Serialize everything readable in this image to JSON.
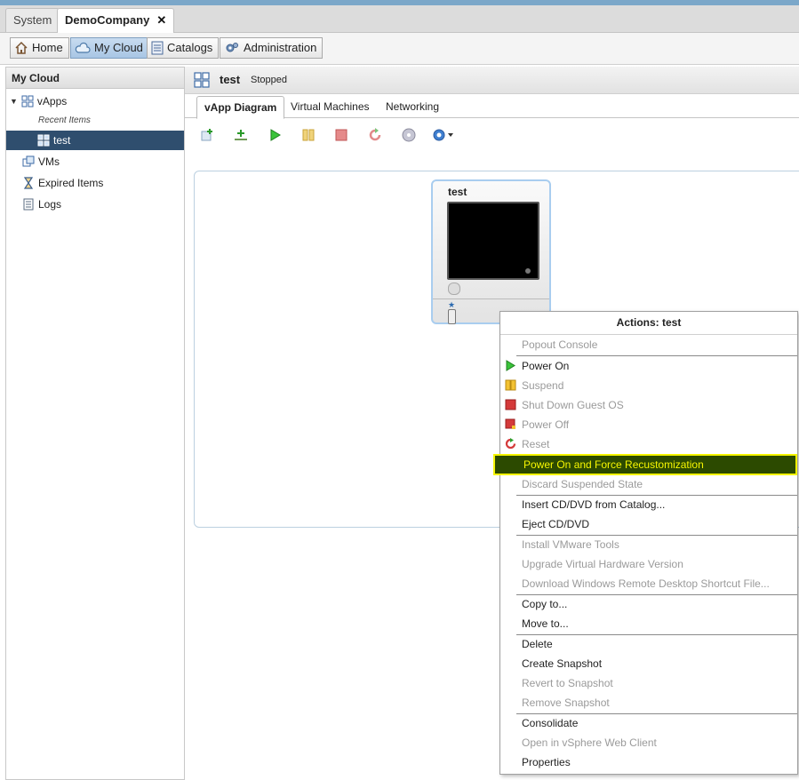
{
  "tabs": {
    "system": "System",
    "demo": "DemoCompany",
    "close": "✕"
  },
  "nav": {
    "home": "Home",
    "mycloud": "My Cloud",
    "catalogs": "Catalogs",
    "administration": "Administration"
  },
  "left_panel": {
    "title": "My Cloud",
    "vapps": "vApps",
    "recent": "Recent Items",
    "test": "test",
    "vms": "VMs",
    "expired": "Expired Items",
    "logs": "Logs"
  },
  "vapp": {
    "name": "test",
    "status": "Stopped"
  },
  "subtabs": {
    "diagram": "vApp Diagram",
    "vms": "Virtual Machines",
    "networking": "Networking"
  },
  "vm_card": {
    "name": "test"
  },
  "menu": {
    "title": "Actions: test",
    "items": [
      "Popout Console",
      "Power On",
      "Suspend",
      "Shut Down Guest OS",
      "Power Off",
      "Reset",
      "Power On and Force Recustomization",
      "Discard Suspended State",
      "Insert CD/DVD from Catalog...",
      "Eject CD/DVD",
      "Install VMware Tools",
      "Upgrade Virtual Hardware Version",
      "Download Windows Remote Desktop Shortcut File...",
      "Copy to...",
      "Move to...",
      "Delete",
      "Create Snapshot",
      "Revert to Snapshot",
      "Remove Snapshot",
      "Consolidate",
      "Open in vSphere Web Client",
      "Properties"
    ]
  },
  "colors": {
    "highlight_bg": "#2c4a00",
    "highlight_text": "#f6f600",
    "selection": "#2f4e6e"
  }
}
